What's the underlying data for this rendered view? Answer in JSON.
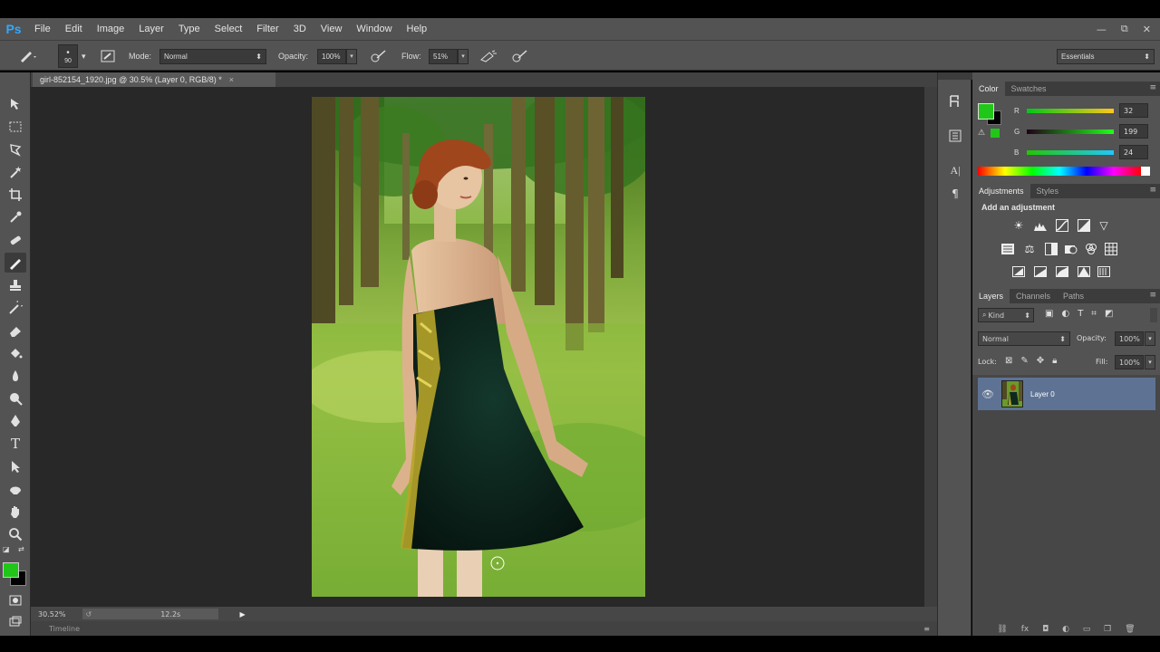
{
  "app": {
    "logo": "Ps"
  },
  "menu": [
    "File",
    "Edit",
    "Image",
    "Layer",
    "Type",
    "Select",
    "Filter",
    "3D",
    "View",
    "Window",
    "Help"
  ],
  "window_controls": [
    "—",
    "⧉",
    "✕"
  ],
  "options": {
    "brush_size": "90",
    "mode_label": "Mode:",
    "mode_value": "Normal",
    "opacity_label": "Opacity:",
    "opacity_value": "100%",
    "flow_label": "Flow:",
    "flow_value": "51%",
    "workspace": "Essentials"
  },
  "document": {
    "tab_title": "girl-852154_1920.jpg @ 30.5% (Layer 0, RGB/8) *",
    "zoom": "30.52%",
    "status_value": "12.2s",
    "timeline_label": "Timeline"
  },
  "color_panel": {
    "tabs": [
      "Color",
      "Swatches"
    ],
    "r_label": "R",
    "g_label": "G",
    "b_label": "B",
    "r": "32",
    "g": "199",
    "b": "24",
    "fg_color": "#20c718",
    "bg_color": "#000000"
  },
  "adjustments_panel": {
    "tabs": [
      "Adjustments",
      "Styles"
    ],
    "heading": "Add an adjustment"
  },
  "layers_panel": {
    "tabs": [
      "Layers",
      "Channels",
      "Paths"
    ],
    "kind_filter": "Kind",
    "blend_mode": "Normal",
    "opacity_label": "Opacity:",
    "opacity_value": "100%",
    "lock_label": "Lock:",
    "fill_label": "Fill:",
    "fill_value": "100%",
    "layers": [
      {
        "name": "Layer 0",
        "visible": true
      }
    ]
  }
}
